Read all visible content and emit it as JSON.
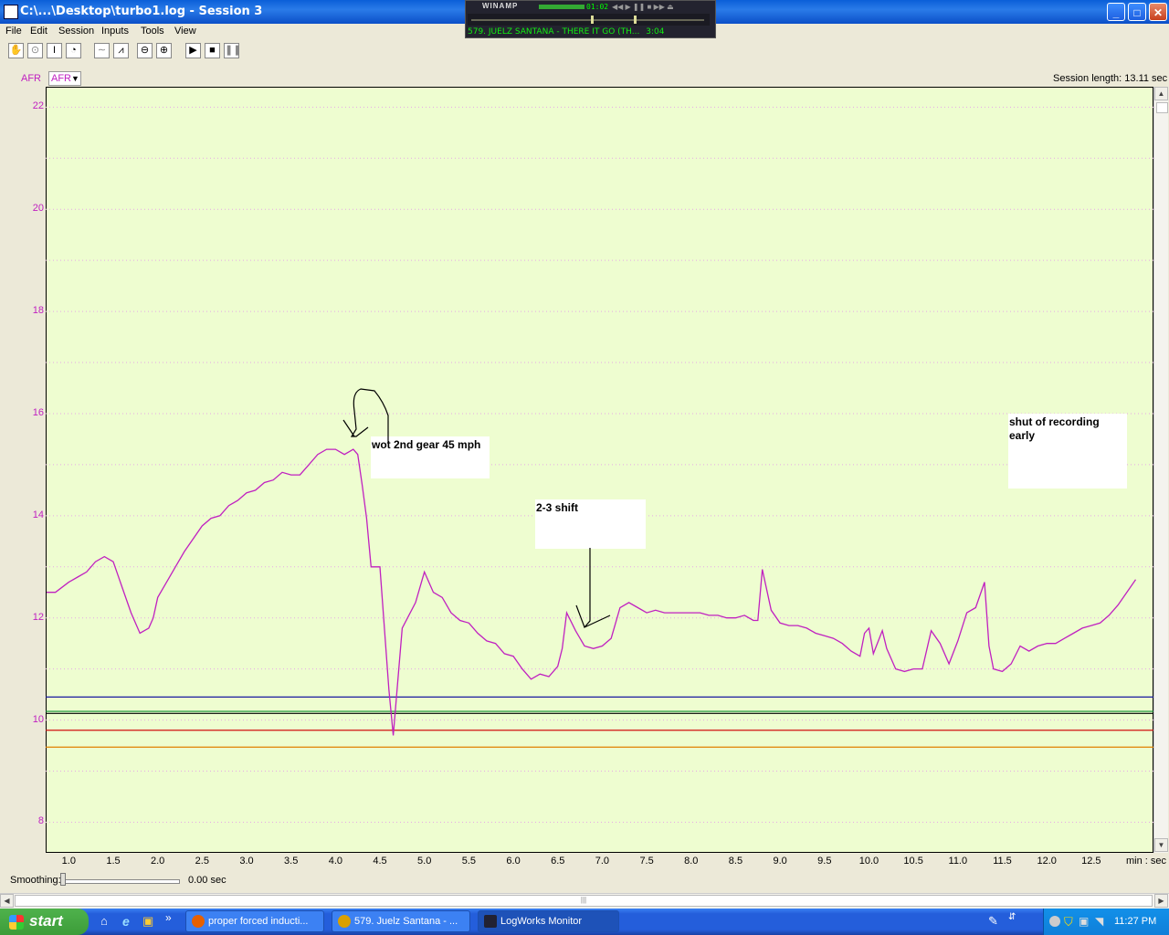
{
  "window": {
    "title": "C:\\...\\Desktop\\turbo1.log - Session 3",
    "controls": [
      "_",
      "□",
      "✕"
    ]
  },
  "winamp": {
    "label": "WINAMP",
    "time": "01:02",
    "track": "579. JUELZ SANTANA - THERE IT GO (TH...",
    "track_time": "3:04"
  },
  "menu": [
    "File",
    "Edit",
    "Session",
    "Inputs",
    "Tools",
    "View"
  ],
  "toolbar": {
    "icons": [
      "hand-icon",
      "zoom-region-icon",
      "cursor-icon",
      "gauge-icon",
      "line-flat-icon",
      "line-wave-icon",
      "zoom-out-icon",
      "zoom-in-icon",
      "play-icon",
      "stop-icon",
      "pause-icon"
    ]
  },
  "channel": {
    "label": "AFR",
    "selected": "AFR"
  },
  "session_length": "Session length:  13.11 sec",
  "x_unit": "min : sec",
  "annotations": {
    "wot": "wot 2nd gear 45 mph",
    "shift": "2-3 shift",
    "shutoff": "shut of recording early"
  },
  "smoothing": {
    "label": "Smoothing:",
    "value": "0.00 sec"
  },
  "taskbar": {
    "start": "start",
    "tasks": [
      "proper forced inducti...",
      "579. Juelz Santana - ...",
      "LogWorks Monitor"
    ],
    "clock": "11:27 PM"
  },
  "colors": {
    "plot_bg": "#eefdd0",
    "afr_trace": "#c020c0",
    "ref_blue": "#1a1aa0",
    "ref_green": "#109030",
    "ref_black": "#000000",
    "ref_red": "#d01010",
    "ref_orange": "#e08000"
  },
  "chart_data": {
    "type": "line",
    "xlabel": "min : sec",
    "ylabel": "AFR",
    "xlim": [
      0.74,
      13.2
    ],
    "ylim": [
      7.4,
      22.4
    ],
    "x_ticks": [
      "1.0",
      "1.5",
      "2.0",
      "2.5",
      "3.0",
      "3.5",
      "4.0",
      "4.5",
      "5.0",
      "5.5",
      "6.0",
      "6.5",
      "7.0",
      "7.5",
      "8.0",
      "8.5",
      "9.0",
      "9.5",
      "10.0",
      "10.5",
      "11.0",
      "11.5",
      "12.0",
      "12.5"
    ],
    "y_ticks": [
      "8",
      "10",
      "12",
      "14",
      "16",
      "18",
      "20",
      "22"
    ],
    "grid": true,
    "series": [
      {
        "name": "AFR",
        "x": [
          0.75,
          0.85,
          1.0,
          1.1,
          1.2,
          1.3,
          1.4,
          1.5,
          1.6,
          1.7,
          1.8,
          1.9,
          1.95,
          2.0,
          2.1,
          2.2,
          2.3,
          2.5,
          2.6,
          2.7,
          2.8,
          2.9,
          3.0,
          3.1,
          3.2,
          3.3,
          3.4,
          3.5,
          3.6,
          3.7,
          3.8,
          3.9,
          4.0,
          4.1,
          4.2,
          4.25,
          4.3,
          4.35,
          4.4,
          4.5,
          4.6,
          4.65,
          4.75,
          4.9,
          5.0,
          5.1,
          5.2,
          5.3,
          5.4,
          5.5,
          5.6,
          5.7,
          5.8,
          5.9,
          6.0,
          6.1,
          6.2,
          6.3,
          6.4,
          6.5,
          6.55,
          6.6,
          6.7,
          6.8,
          6.9,
          7.0,
          7.1,
          7.2,
          7.3,
          7.4,
          7.5,
          7.6,
          7.7,
          7.8,
          7.9,
          8.0,
          8.1,
          8.2,
          8.3,
          8.4,
          8.5,
          8.6,
          8.7,
          8.75,
          8.8,
          8.9,
          9.0,
          9.1,
          9.2,
          9.3,
          9.4,
          9.5,
          9.6,
          9.7,
          9.8,
          9.9,
          9.95,
          10.0,
          10.05,
          10.15,
          10.2,
          10.3,
          10.4,
          10.5,
          10.6,
          10.7,
          10.8,
          10.9,
          11.0,
          11.1,
          11.2,
          11.3,
          11.35,
          11.4,
          11.5,
          11.6,
          11.7,
          11.8,
          11.9,
          12.0,
          12.1,
          12.2,
          12.3,
          12.4,
          12.5,
          12.6,
          12.7,
          12.8,
          12.9,
          13.0
        ],
        "values": [
          12.5,
          12.5,
          12.7,
          12.8,
          12.9,
          13.1,
          13.2,
          13.1,
          12.6,
          12.1,
          11.7,
          11.8,
          12.0,
          12.4,
          12.7,
          13.0,
          13.3,
          13.8,
          13.95,
          14.0,
          14.2,
          14.3,
          14.45,
          14.5,
          14.65,
          14.7,
          14.85,
          14.8,
          14.8,
          15.0,
          15.2,
          15.3,
          15.3,
          15.2,
          15.3,
          15.2,
          14.6,
          13.95,
          13.0,
          13.0,
          10.6,
          9.7,
          11.8,
          12.3,
          12.9,
          12.5,
          12.4,
          12.1,
          11.95,
          11.9,
          11.7,
          11.55,
          11.5,
          11.3,
          11.25,
          11.0,
          10.8,
          10.9,
          10.85,
          11.05,
          11.4,
          12.1,
          11.75,
          11.45,
          11.4,
          11.45,
          11.6,
          12.2,
          12.3,
          12.2,
          12.1,
          12.15,
          12.1,
          12.1,
          12.1,
          12.1,
          12.1,
          12.05,
          12.05,
          12.0,
          12.0,
          12.05,
          11.95,
          11.95,
          12.95,
          12.15,
          11.9,
          11.85,
          11.85,
          11.8,
          11.7,
          11.65,
          11.6,
          11.5,
          11.35,
          11.25,
          11.7,
          11.8,
          11.3,
          11.75,
          11.4,
          11.0,
          10.95,
          11.0,
          11.0,
          11.75,
          11.5,
          11.1,
          11.55,
          12.1,
          12.2,
          12.7,
          11.45,
          11.0,
          10.95,
          11.1,
          11.45,
          11.35,
          11.45,
          11.5,
          11.5,
          11.6,
          11.7,
          11.8,
          11.85,
          11.9,
          12.05,
          12.25,
          12.5,
          12.75
        ]
      }
    ],
    "reference_lines": [
      {
        "color": "#1a1aa0",
        "value": 10.45
      },
      {
        "color": "#109030",
        "value": 10.17
      },
      {
        "color": "#000000",
        "value": 10.13
      },
      {
        "color": "#d01010",
        "value": 9.8
      },
      {
        "color": "#e08000",
        "value": 9.47
      }
    ]
  }
}
